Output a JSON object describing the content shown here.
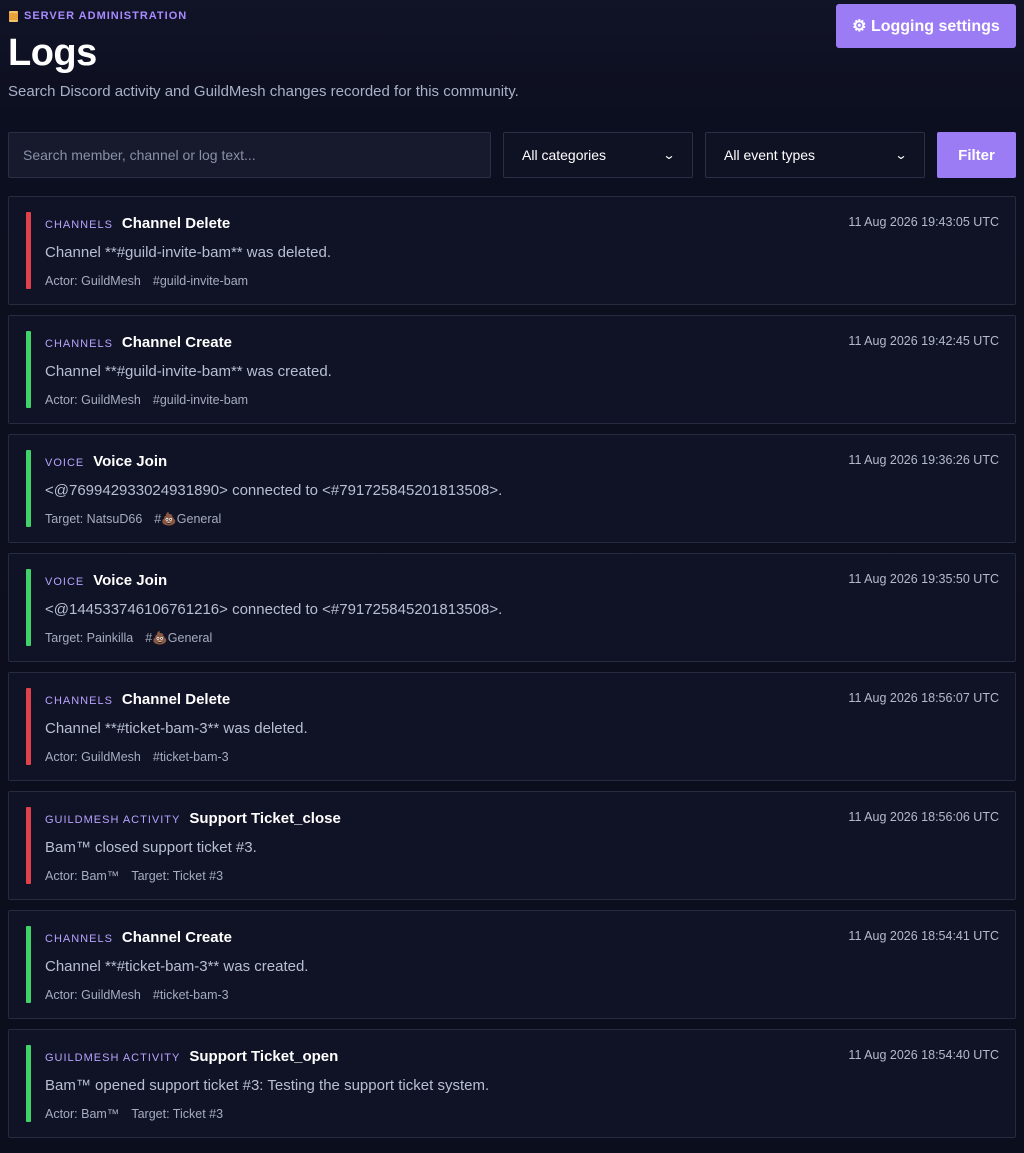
{
  "header": {
    "eyebrow": "SERVER ADMINISTRATION",
    "eyebrow_icon": "scroll-icon",
    "title": "Logs",
    "subtitle": "Search Discord activity and GuildMesh changes recorded for this community.",
    "settings_button": "⚙ Logging settings"
  },
  "filters": {
    "search_placeholder": "Search member, channel or log text...",
    "search_value": "",
    "category_selected": "All categories",
    "event_type_selected": "All event types",
    "filter_button": "Filter"
  },
  "colors": {
    "accent": "#9b7cf4",
    "delete_red": "#e0424c",
    "create_green": "#3fd36a"
  },
  "logs": [
    {
      "category": "CHANNELS",
      "event": "Channel Delete",
      "timestamp": "11 Aug 2026 19:43:05 UTC",
      "message": "Channel **#guild-invite-bam** was deleted.",
      "meta1": "Actor: GuildMesh",
      "meta2": "#guild-invite-bam",
      "status": "red"
    },
    {
      "category": "CHANNELS",
      "event": "Channel Create",
      "timestamp": "11 Aug 2026 19:42:45 UTC",
      "message": "Channel **#guild-invite-bam** was created.",
      "meta1": "Actor: GuildMesh",
      "meta2": "#guild-invite-bam",
      "status": "green"
    },
    {
      "category": "VOICE",
      "event": "Voice Join",
      "timestamp": "11 Aug 2026 19:36:26 UTC",
      "message": "<@769942933024931890> connected to <#791725845201813508>.",
      "meta1": "Target: NatsuD66",
      "meta2": "#💩General",
      "status": "green"
    },
    {
      "category": "VOICE",
      "event": "Voice Join",
      "timestamp": "11 Aug 2026 19:35:50 UTC",
      "message": "<@144533746106761216> connected to <#791725845201813508>.",
      "meta1": "Target: Painkilla",
      "meta2": "#💩General",
      "status": "green"
    },
    {
      "category": "CHANNELS",
      "event": "Channel Delete",
      "timestamp": "11 Aug 2026 18:56:07 UTC",
      "message": "Channel **#ticket-bam-3** was deleted.",
      "meta1": "Actor: GuildMesh",
      "meta2": "#ticket-bam-3",
      "status": "red"
    },
    {
      "category": "GUILDMESH ACTIVITY",
      "event": "Support Ticket_close",
      "timestamp": "11 Aug 2026 18:56:06 UTC",
      "message": "Bam™ closed support ticket #3.",
      "meta1": "Actor: Bam™",
      "meta2": "Target: Ticket #3",
      "status": "red"
    },
    {
      "category": "CHANNELS",
      "event": "Channel Create",
      "timestamp": "11 Aug 2026 18:54:41 UTC",
      "message": "Channel **#ticket-bam-3** was created.",
      "meta1": "Actor: GuildMesh",
      "meta2": "#ticket-bam-3",
      "status": "green"
    },
    {
      "category": "GUILDMESH ACTIVITY",
      "event": "Support Ticket_open",
      "timestamp": "11 Aug 2026 18:54:40 UTC",
      "message": "Bam™ opened support ticket #3: Testing the support ticket system.",
      "meta1": "Actor: Bam™",
      "meta2": "Target: Ticket #3",
      "status": "green"
    }
  ]
}
